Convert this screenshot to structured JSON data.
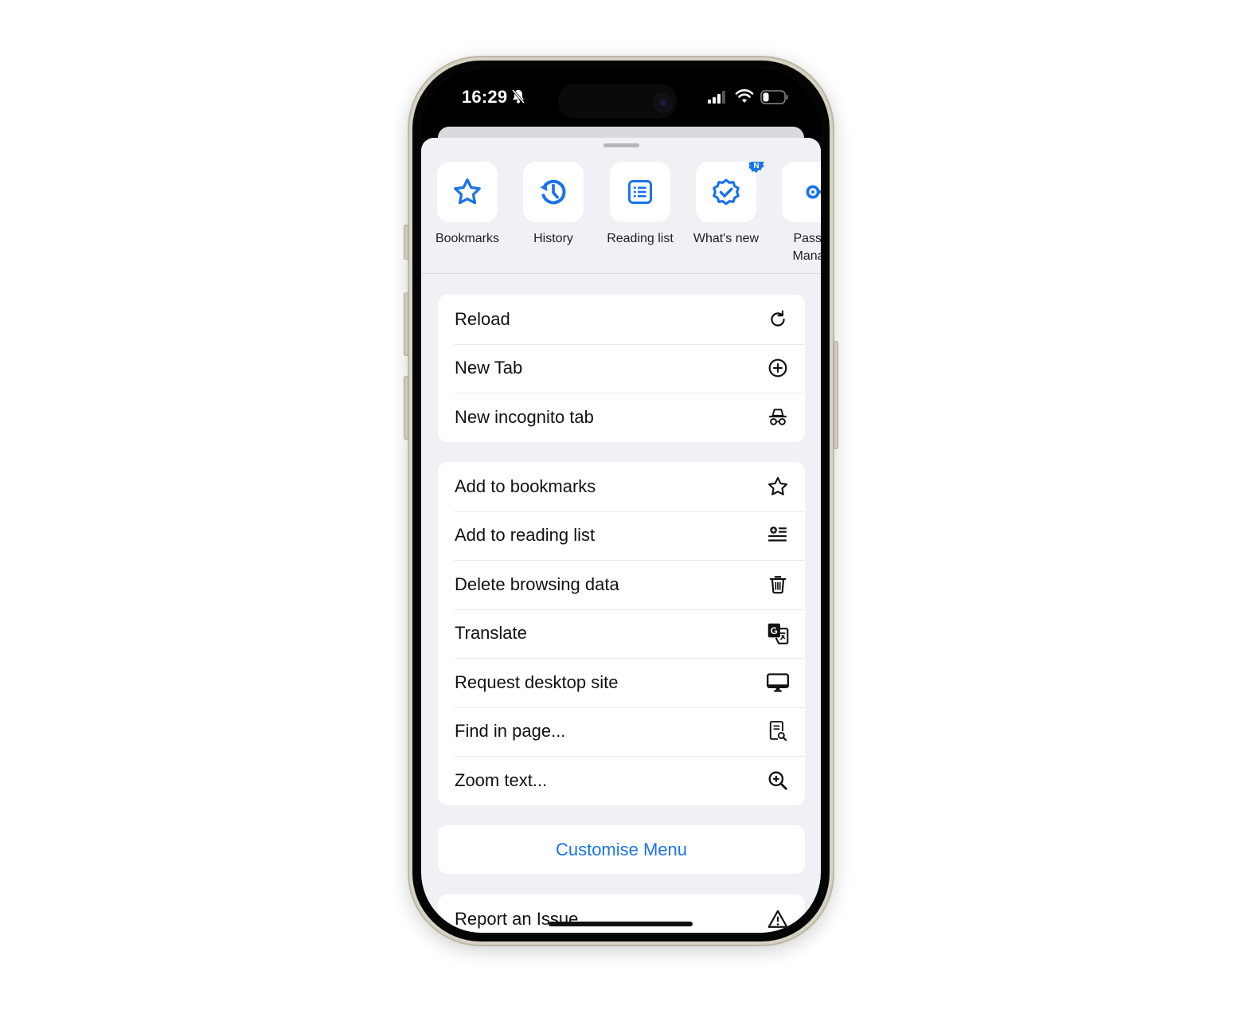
{
  "status_bar": {
    "time": "16:29",
    "silent_icon": "bell-slash-icon",
    "signal_icon": "cellular-signal-icon",
    "wifi_icon": "wifi-icon",
    "battery_icon": "battery-icon"
  },
  "shortcuts": [
    {
      "label": "Bookmarks",
      "icon": "star-icon"
    },
    {
      "label": "History",
      "icon": "history-icon"
    },
    {
      "label": "Reading list",
      "icon": "reading-list-icon"
    },
    {
      "label": "What's new",
      "icon": "verified-badge-icon",
      "badge": "N"
    },
    {
      "label": "Password Manager",
      "label_visible": "Passw\nManag",
      "icon": "key-icon"
    }
  ],
  "menu_group_1": [
    {
      "label": "Reload",
      "icon": "reload-icon"
    },
    {
      "label": "New Tab",
      "icon": "plus-circle-icon"
    },
    {
      "label": "New incognito tab",
      "icon": "incognito-icon"
    }
  ],
  "menu_group_2": [
    {
      "label": "Add to bookmarks",
      "icon": "star-outline-icon"
    },
    {
      "label": "Add to reading list",
      "icon": "add-to-list-icon"
    },
    {
      "label": "Delete browsing data",
      "icon": "trash-icon"
    },
    {
      "label": "Translate",
      "icon": "translate-icon"
    },
    {
      "label": "Request desktop site",
      "icon": "desktop-icon"
    },
    {
      "label": "Find in page...",
      "icon": "find-in-page-icon"
    },
    {
      "label": "Zoom text...",
      "icon": "zoom-in-icon"
    }
  ],
  "customise_menu": "Customise Menu",
  "menu_group_3": [
    {
      "label": "Report an Issue",
      "icon": "warning-icon"
    }
  ],
  "colors": {
    "accent": "#1a73e8",
    "sheet_background": "#f0f1f5",
    "card_background": "#ffffff",
    "text": "#111111"
  }
}
